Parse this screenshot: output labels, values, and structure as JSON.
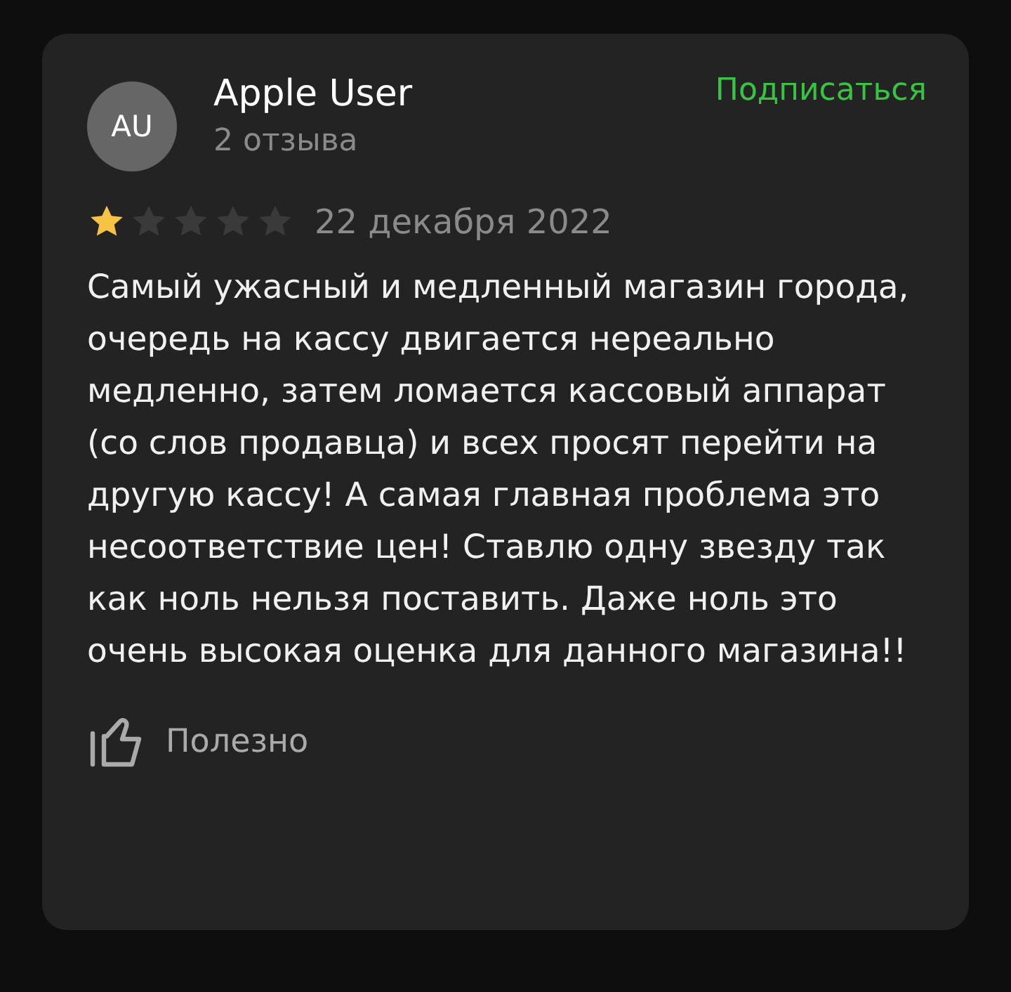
{
  "review": {
    "avatar": "AU",
    "author": "Apple User",
    "reviews_count": "2 отзыва",
    "subscribe": "Подписаться",
    "stars": 1,
    "date": "22 декабря 2022",
    "text": "Самый ужасный и медленный магазин города, очередь на кассу двигается нереально медленно, затем ломается кассовый аппарат (со слов продавца) и всех просят перейти на другую кассу! А самая главная проблема это несоответствие цен! Ставлю одну звезду так как ноль нельзя поставить. Даже ноль это очень высокая оценка для данного магазина!!",
    "helpful": "Полезно"
  }
}
